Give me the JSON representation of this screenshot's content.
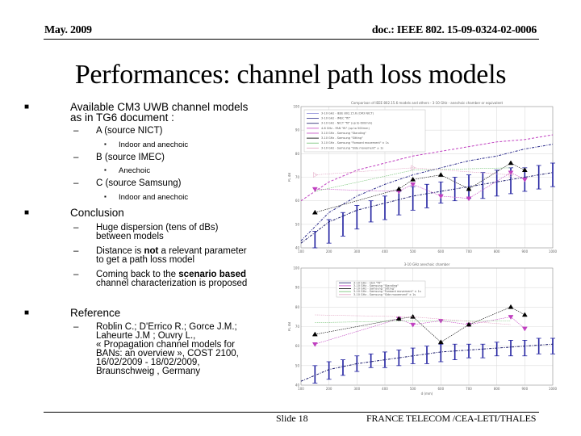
{
  "header": {
    "date": "May. 2009",
    "doc_id": "doc.: IEEE 802. 15-09-0324-02-0006"
  },
  "title": "Performances: channel path loss models",
  "bullets": {
    "available": {
      "label_line1": "Available CM3 UWB channel models",
      "label_line2": "as in TG6 document :",
      "items": [
        {
          "label": "A (source NICT)",
          "sub": "Indoor and anechoic"
        },
        {
          "label": "B (source IMEC)",
          "sub": "Anechoic"
        },
        {
          "label": "C (source Samsung)",
          "sub": "Indoor and anechoic"
        }
      ]
    },
    "conclusion": {
      "label": "Conclusion",
      "items": [
        {
          "line1": "Huge dispersion (tens of dBs)",
          "line2": "between models"
        },
        {
          "line1_pre": "Distance is ",
          "line1_bold": "not",
          "line1_post": " a relevant parameter",
          "line2": "to get a path loss model"
        },
        {
          "line1_pre": "Coming back to the ",
          "line1_bold": "scenario based",
          "line2": "channel characterization is proposed"
        }
      ]
    },
    "reference": {
      "label": "Reference",
      "lines": [
        "Roblin C.; D'Errico R.; Gorce J.M.;",
        "Laheurte J.M ; Ouvry L.,",
        "« Propagation channel models for",
        "BANs: an overview », COST 2100,",
        "16/02/2009 - 18/02/2009,",
        "Braunschweig , Germany"
      ]
    }
  },
  "footer": {
    "slide": "Slide 18",
    "organization": "FRANCE TELECOM /CEA-LETI/THALES"
  },
  "chart_data": [
    {
      "type": "line",
      "title": "Comparison of IEEE 802.15.6 models and others - 3-10 GHz - anechoic chamber or equivalent",
      "xlabel": "",
      "ylabel": "PL dB",
      "xlim": [
        100,
        1000
      ],
      "ylim": [
        40,
        100
      ],
      "xticks": [
        "100",
        "200",
        "300",
        "400",
        "500",
        "600",
        "700",
        "800",
        "900",
        "1000"
      ],
      "yticks": [
        "40",
        "50",
        "60",
        "70",
        "80",
        "90",
        "100"
      ],
      "grid": true,
      "legend_position": "top-left",
      "series": [
        {
          "name": "3-10 GHz - IEEE 802.15.6 (CM3 NICT)",
          "color": "#8a8ad8",
          "style": "solid",
          "x": [
            100,
            1000
          ],
          "y": [
            40,
            40
          ]
        },
        {
          "name": "3-10 GHz - IMEC \"fit\"",
          "color": "#2a2a8a",
          "style": "dashdot",
          "x": [
            100,
            200,
            300,
            400,
            500,
            600,
            700,
            800,
            900,
            1000
          ],
          "y": [
            43,
            55,
            62,
            67,
            71,
            74,
            77,
            79,
            82,
            84
          ]
        },
        {
          "name": "3-10 GHz - NICT \"fit\" (up to 600mm)",
          "color": "#1a1a6a",
          "style": "dashdot",
          "x": [
            100,
            200,
            300,
            400,
            500,
            600,
            700,
            800,
            900,
            1000
          ],
          "y": [
            42,
            51,
            56,
            59,
            62,
            64,
            66,
            68,
            70,
            72
          ]
        },
        {
          "name": "4-8 GHz - PAN \"fit\" (up to 500mm)",
          "color": "#c040c0",
          "style": "dashed",
          "x": [
            100,
            200,
            300,
            400,
            500,
            600,
            700,
            800,
            900,
            1000
          ],
          "y": [
            60,
            68,
            73,
            76,
            79,
            81,
            83,
            85,
            86,
            88
          ]
        },
        {
          "name": "3-10 GHz - Samsung \"Standing\"",
          "color": "#c040c0",
          "marker": "triangle-down",
          "x": [
            150,
            450,
            500,
            600,
            700,
            850,
            900
          ],
          "y": [
            65,
            64,
            67,
            62,
            61,
            72,
            69
          ]
        },
        {
          "name": "3-10 GHz - Samsung \"Sitting\"",
          "color": "#000000",
          "marker": "triangle-up",
          "x": [
            150,
            450,
            500,
            600,
            700,
            850,
            900
          ],
          "y": [
            55,
            65,
            69,
            71,
            65,
            76,
            73
          ]
        },
        {
          "name": "3-10 GHz - Samsung \"Forward movement\" ± 1s",
          "color": "#70c070",
          "marker": "none",
          "x": [
            150,
            500,
            850
          ],
          "y": [
            64,
            73,
            74
          ]
        },
        {
          "name": "3-10 GHz - Samsung \"Side movement\" ± 1s",
          "color": "#e0a0c0",
          "marker": "triangle-right",
          "x": [
            150,
            500,
            850
          ],
          "y": [
            71,
            74,
            71
          ]
        }
      ],
      "error_bars": {
        "color": "#2020a0",
        "x": [
          150,
          200,
          250,
          300,
          350,
          400,
          450,
          500,
          550,
          600,
          650,
          700,
          750,
          800,
          850,
          900,
          950,
          1000
        ],
        "low": [
          40,
          42,
          45,
          48,
          51,
          52,
          54,
          56,
          57,
          59,
          60,
          61,
          61,
          62,
          63,
          64,
          65,
          66
        ],
        "high": [
          47,
          52,
          55,
          58,
          60,
          62,
          64,
          66,
          67,
          68,
          70,
          71,
          72,
          73,
          74,
          74,
          75,
          76
        ]
      }
    },
    {
      "type": "line",
      "title": "3-10 GHz anechoic chamber",
      "xlabel": "d (mm)",
      "ylabel": "PL dB",
      "xlim": [
        100,
        1000
      ],
      "ylim": [
        40,
        100
      ],
      "xticks": [
        "100",
        "200",
        "300",
        "400",
        "500",
        "600",
        "700",
        "800",
        "900",
        "1000"
      ],
      "yticks": [
        "40",
        "50",
        "60",
        "70",
        "80",
        "90",
        "100"
      ],
      "grid": true,
      "legend_position": "top-left",
      "series": [
        {
          "name": "3-10 GHz - CEA \"fit\"",
          "color": "#1a1a6a",
          "style": "dashdot",
          "x": [
            100,
            150,
            200,
            300,
            400,
            500,
            600,
            700,
            800,
            900,
            1000
          ],
          "y": [
            42,
            45,
            48,
            51,
            53,
            55,
            57,
            58,
            59,
            60,
            61
          ]
        },
        {
          "name": "3-10 GHz - Samsung \"Standing\"",
          "color": "#c040c0",
          "marker": "triangle-down",
          "x": [
            150,
            450,
            500,
            600,
            700,
            850,
            900
          ],
          "y": [
            61,
            74,
            71,
            73,
            71,
            75,
            69
          ]
        },
        {
          "name": "3-10 GHz - Samsung \"Sitting\"",
          "color": "#000000",
          "marker": "triangle-up",
          "x": [
            150,
            450,
            500,
            600,
            700,
            850,
            900
          ],
          "y": [
            66,
            74,
            75,
            62,
            71,
            80,
            76
          ]
        },
        {
          "name": "3-10 GHz - Samsung \"Forward movement\" ± 1s",
          "color": "#70c070",
          "marker": "none",
          "x": [
            150,
            500,
            850
          ],
          "y": [
            72,
            73,
            73
          ]
        },
        {
          "name": "3-10 GHz - Samsung \"Side movement\" ± 1s",
          "color": "#e0a0c0",
          "marker": "none",
          "x": [
            150,
            500,
            850
          ],
          "y": [
            76,
            75,
            71
          ]
        }
      ],
      "error_bars": {
        "color": "#2020a0",
        "x": [
          150,
          200,
          250,
          300,
          350,
          400,
          450,
          500,
          550,
          600,
          650,
          700,
          750,
          800,
          850,
          900,
          950,
          1000
        ],
        "low": [
          41,
          43,
          45,
          47,
          49,
          49,
          50,
          51,
          51,
          52,
          53,
          54,
          54,
          55,
          55,
          55,
          56,
          56
        ],
        "high": [
          50,
          52,
          53,
          55,
          56,
          57,
          58,
          59,
          60,
          61,
          61,
          61,
          61,
          62,
          63,
          63,
          64,
          64
        ]
      }
    }
  ]
}
